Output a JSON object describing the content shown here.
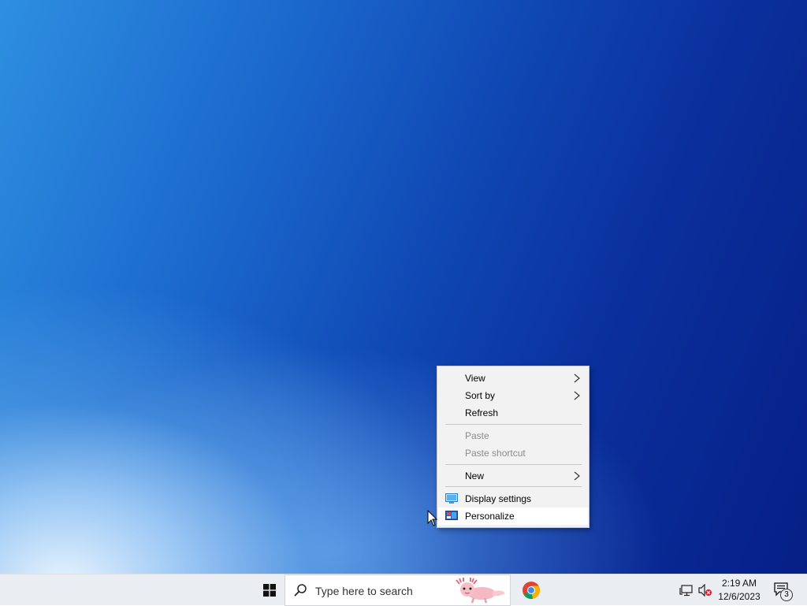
{
  "context_menu": {
    "items": [
      {
        "label": "View",
        "enabled": true,
        "submenu": true
      },
      {
        "label": "Sort by",
        "enabled": true,
        "submenu": true
      },
      {
        "label": "Refresh",
        "enabled": true,
        "submenu": false
      },
      {
        "label": "Paste",
        "enabled": false,
        "submenu": false
      },
      {
        "label": "Paste shortcut",
        "enabled": false,
        "submenu": false
      },
      {
        "label": "New",
        "enabled": true,
        "submenu": true
      },
      {
        "label": "Display settings",
        "enabled": true,
        "icon": "display-settings-icon"
      },
      {
        "label": "Personalize",
        "enabled": true,
        "icon": "personalize-icon",
        "highlighted": true
      }
    ]
  },
  "taskbar": {
    "search_placeholder": "Type here to search",
    "pinned_apps": [
      "chrome-icon"
    ],
    "tray_icons": [
      "network-icon",
      "volume-muted-icon"
    ],
    "clock": {
      "time": "2:19 AM",
      "date": "12/6/2023"
    },
    "notification_count": "3"
  },
  "colors": {
    "menu_background": "#f2f2f2",
    "taskbar_background": "#eaedf2",
    "wallpaper_dark": "#061f86",
    "wallpaper_light": "#2e8fe0"
  }
}
